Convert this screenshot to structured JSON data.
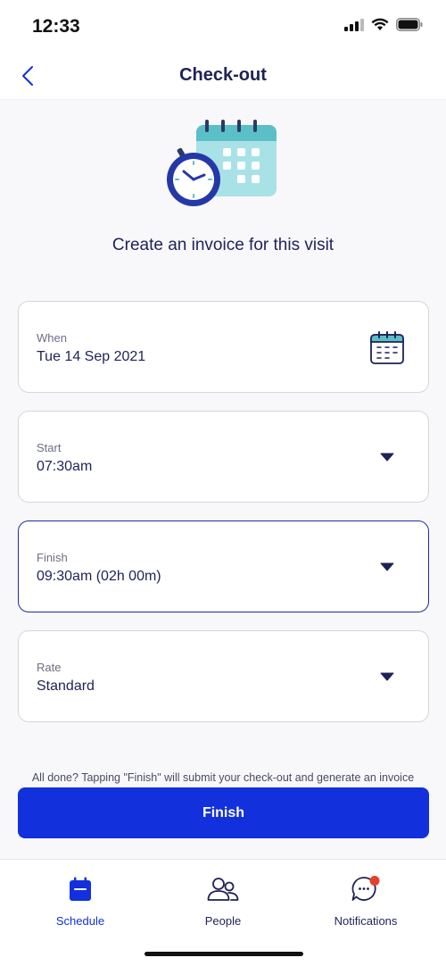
{
  "status": {
    "time": "12:33"
  },
  "header": {
    "title": "Check-out"
  },
  "subtitle": "Create an invoice for this visit",
  "fields": [
    {
      "label": "When",
      "value": "Tue 14 Sep 2021",
      "icon": "calendar-icon"
    },
    {
      "label": "Start",
      "value": "07:30am",
      "icon": "caret-down-icon"
    },
    {
      "label": "Finish",
      "value": "09:30am (02h 00m)",
      "icon": "caret-down-icon"
    },
    {
      "label": "Rate",
      "value": "Standard",
      "icon": "caret-down-icon"
    }
  ],
  "hint": "All done? Tapping \"Finish\" will submit your check-out and generate an invoice",
  "finish_button": "Finish",
  "tabs": [
    {
      "label": "Schedule",
      "icon": "calendar-icon",
      "active": true
    },
    {
      "label": "People",
      "icon": "people-icon",
      "active": false
    },
    {
      "label": "Notifications",
      "icon": "chat-bubble-icon",
      "active": false,
      "badge": true
    }
  ],
  "colors": {
    "primary": "#1230dc",
    "text": "#1f2257",
    "active_border": "#1c2ea3",
    "badge": "#e5402d"
  }
}
